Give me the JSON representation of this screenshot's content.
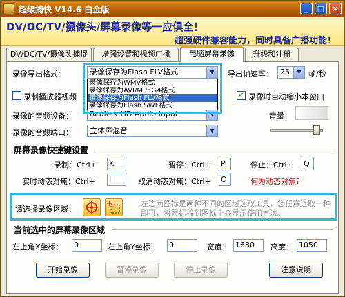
{
  "window": {
    "title": "超级捕快 V14.6 白金版",
    "controls": {
      "minimize": "_",
      "maximize": "□",
      "close": "×"
    }
  },
  "banner": {
    "line1": "DV/DC/TV/摄像头/屏幕录像等一应俱全！",
    "line2": "超强硬件兼容能力，同时具备广播功能！"
  },
  "tabs": [
    {
      "label": "DV/DC/TV/摄像头捕捉",
      "active": false
    },
    {
      "label": "增强设置和视频广播",
      "active": false
    },
    {
      "label": "电脑屏幕录像",
      "active": true
    },
    {
      "label": "升级和注册",
      "active": false
    }
  ],
  "export_format": {
    "label": "录像导出格式：",
    "selected": "录像保存为Flash FLV格式",
    "options": [
      "录像保存为WMV格式",
      "录像保存为AVI/MPEG4格式",
      "录像保存为Flash FLV格式",
      "录像保存为Flash SWF格式"
    ]
  },
  "frame_rate": {
    "label": "导出帧速率：",
    "value": "25",
    "unit": "帧/秒"
  },
  "record_player_video": {
    "label": "录制播放器视频"
  },
  "auto_minimize": {
    "label": "录像时自动缩小本窗口",
    "checked": true
  },
  "audio_device": {
    "label": "录像的音频设备：",
    "value": "Realtek HD Audio Input"
  },
  "audio_port": {
    "label": "录像的音频端口：",
    "value": "立体声混音"
  },
  "volume": {
    "label": "音量：",
    "level": 0.88
  },
  "hotkeys": {
    "title": "屏幕录像快捷键设置",
    "record_label": "录制：Ctrl+",
    "record_key": "K",
    "pause_label": "暂停：Ctrl+",
    "pause_key": "P",
    "stop_label": "停止：Ctrl+",
    "stop_key": "Q",
    "realtime_label": "实时动态对焦：Ctrl+",
    "realtime_key": "I",
    "cancel_label": "取消动态对焦：Ctrl+",
    "cancel_key": "O",
    "help_link": "何为动态对焦?"
  },
  "region": {
    "label": "请选择录像区域：",
    "hint": "左边两图标是两种不同的区域选取工具，您任意选取一种即可，将鼠标移到图标上会显示使用方法。"
  },
  "current_region": {
    "title": "当前选中的屏幕录像区域",
    "x_label": "左上角X坐标：",
    "x_value": "0",
    "y_label": "左上角Y坐标：",
    "y_value": "0",
    "width_label": "宽度：",
    "width_value": "1680",
    "height_label": "高度：",
    "height_value": "1050"
  },
  "buttons": {
    "start": "开始录像",
    "pause": "暂停录像",
    "stop": "停止录像",
    "notes": "注意说明"
  }
}
